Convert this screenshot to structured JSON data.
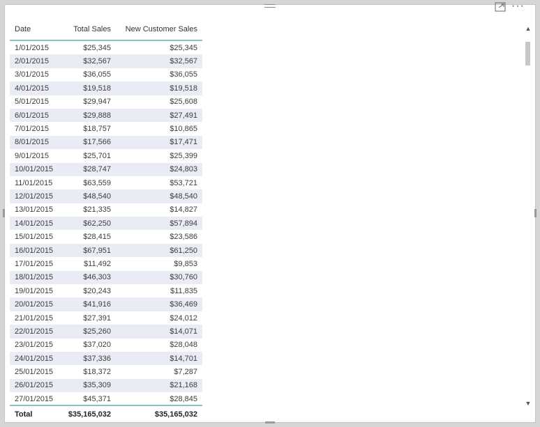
{
  "table": {
    "headers": [
      "Date",
      "Total Sales",
      "New Customer Sales"
    ],
    "rows": [
      [
        "1/01/2015",
        "$25,345",
        "$25,345"
      ],
      [
        "2/01/2015",
        "$32,567",
        "$32,567"
      ],
      [
        "3/01/2015",
        "$36,055",
        "$36,055"
      ],
      [
        "4/01/2015",
        "$19,518",
        "$19,518"
      ],
      [
        "5/01/2015",
        "$29,947",
        "$25,608"
      ],
      [
        "6/01/2015",
        "$29,888",
        "$27,491"
      ],
      [
        "7/01/2015",
        "$18,757",
        "$10,865"
      ],
      [
        "8/01/2015",
        "$17,566",
        "$17,471"
      ],
      [
        "9/01/2015",
        "$25,701",
        "$25,399"
      ],
      [
        "10/01/2015",
        "$28,747",
        "$24,803"
      ],
      [
        "11/01/2015",
        "$63,559",
        "$53,721"
      ],
      [
        "12/01/2015",
        "$48,540",
        "$48,540"
      ],
      [
        "13/01/2015",
        "$21,335",
        "$14,827"
      ],
      [
        "14/01/2015",
        "$62,250",
        "$57,894"
      ],
      [
        "15/01/2015",
        "$28,415",
        "$23,586"
      ],
      [
        "16/01/2015",
        "$67,951",
        "$61,250"
      ],
      [
        "17/01/2015",
        "$11,492",
        "$9,853"
      ],
      [
        "18/01/2015",
        "$46,303",
        "$30,760"
      ],
      [
        "19/01/2015",
        "$20,243",
        "$11,835"
      ],
      [
        "20/01/2015",
        "$41,916",
        "$36,469"
      ],
      [
        "21/01/2015",
        "$27,391",
        "$24,012"
      ],
      [
        "22/01/2015",
        "$25,260",
        "$14,071"
      ],
      [
        "23/01/2015",
        "$37,020",
        "$28,048"
      ],
      [
        "24/01/2015",
        "$37,336",
        "$14,701"
      ],
      [
        "25/01/2015",
        "$18,372",
        "$7,287"
      ],
      [
        "26/01/2015",
        "$35,309",
        "$21,168"
      ],
      [
        "27/01/2015",
        "$45,371",
        "$28,845"
      ]
    ],
    "total": [
      "Total",
      "$35,165,032",
      "$35,165,032"
    ]
  },
  "icons": {
    "focus_mode": "focus-mode-icon",
    "more_options": "more-options-icon",
    "drag_handle": "drag-handle-icon"
  },
  "more_options_glyph": "···",
  "scroll_up_glyph": "▲",
  "scroll_down_glyph": "▼",
  "colors": {
    "accent": "#7ec8c4",
    "band": "#e9ecf5"
  }
}
